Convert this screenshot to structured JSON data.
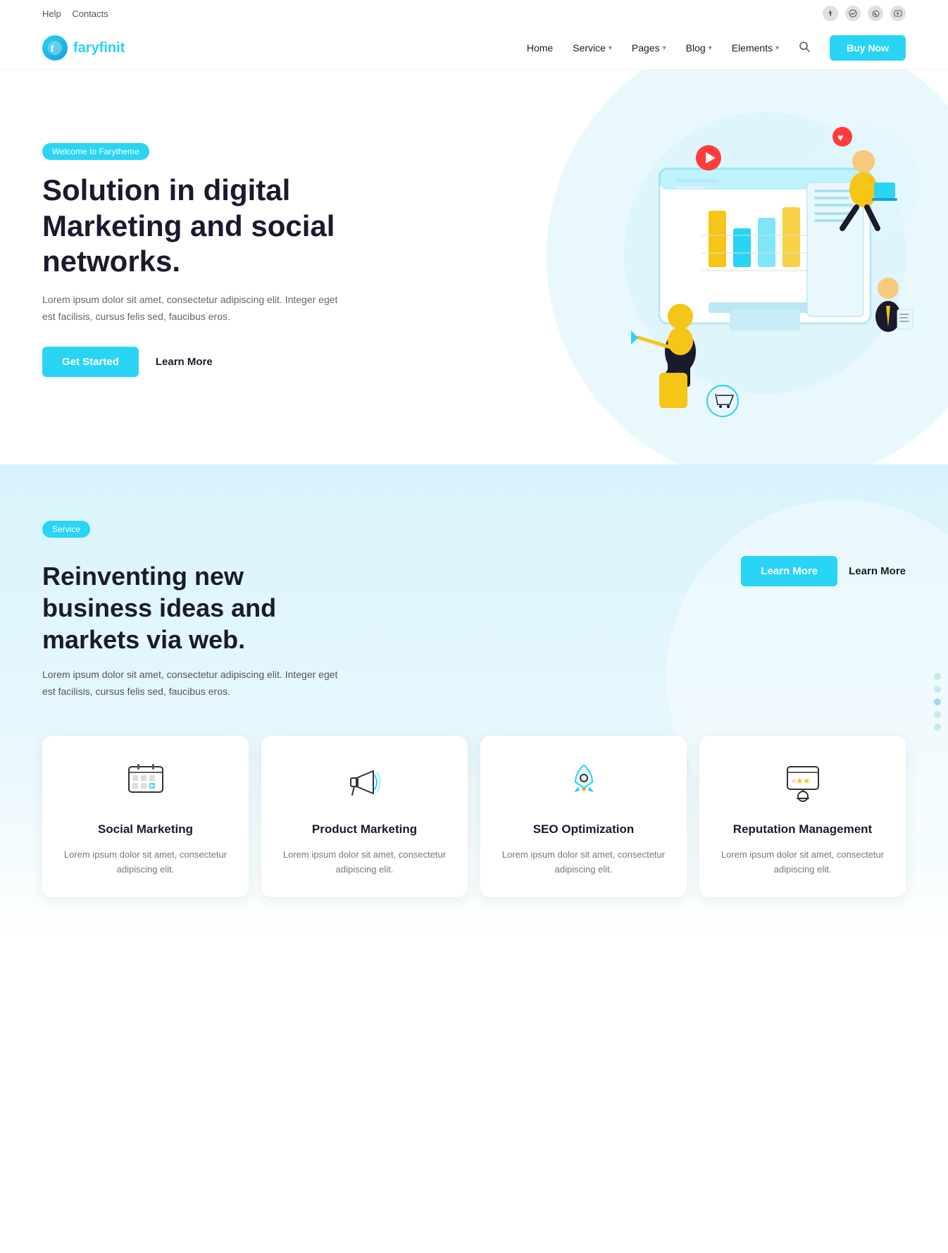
{
  "topbar": {
    "help": "Help",
    "contacts": "Contacts",
    "social": [
      "facebook",
      "messenger",
      "whatsapp",
      "youtube"
    ]
  },
  "navbar": {
    "logo_letter": "f",
    "logo_brand_1": "fary",
    "logo_brand_2": "finit",
    "nav_items": [
      {
        "label": "Home",
        "has_dropdown": false
      },
      {
        "label": "Service",
        "has_dropdown": true
      },
      {
        "label": "Pages",
        "has_dropdown": true
      },
      {
        "label": "Blog",
        "has_dropdown": true
      },
      {
        "label": "Elements",
        "has_dropdown": true
      }
    ],
    "buy_now": "Buy Now"
  },
  "hero": {
    "badge": "Welcome to Farytheme",
    "title": "Solution in digital Marketing and social networks.",
    "description": "Lorem ipsum dolor sit amet, consectetur adipiscing elit. Integer eget est facilisis, cursus felis sed, faucibus eros.",
    "btn_get_started": "Get Started",
    "btn_learn_more": "Learn More"
  },
  "service": {
    "badge": "Service",
    "title": "Reinventing new business ideas and markets via web.",
    "description": "Lorem ipsum dolor sit amet, consectetur adipiscing elit. Integer eget est facilisis, cursus felis sed, faucibus eros.",
    "btn_learn_filled": "Learn More",
    "btn_learn_outline": "Learn More",
    "cards": [
      {
        "id": "social-marketing",
        "title": "Social Marketing",
        "description": "Lorem ipsum dolor sit amet, consectetur adipiscing elit.",
        "icon": "calendar"
      },
      {
        "id": "product-marketing",
        "title": "Product Marketing",
        "description": "Lorem ipsum dolor sit amet, consectetur adipiscing elit.",
        "icon": "megaphone"
      },
      {
        "id": "seo-optimization",
        "title": "SEO Optimization",
        "description": "Lorem ipsum dolor sit amet, consectetur adipiscing elit.",
        "icon": "rocket"
      },
      {
        "id": "reputation-management",
        "title": "Reputation Management",
        "description": "Lorem ipsum dolor sit amet, consectetur adipiscing elit.",
        "icon": "star-person"
      }
    ]
  }
}
